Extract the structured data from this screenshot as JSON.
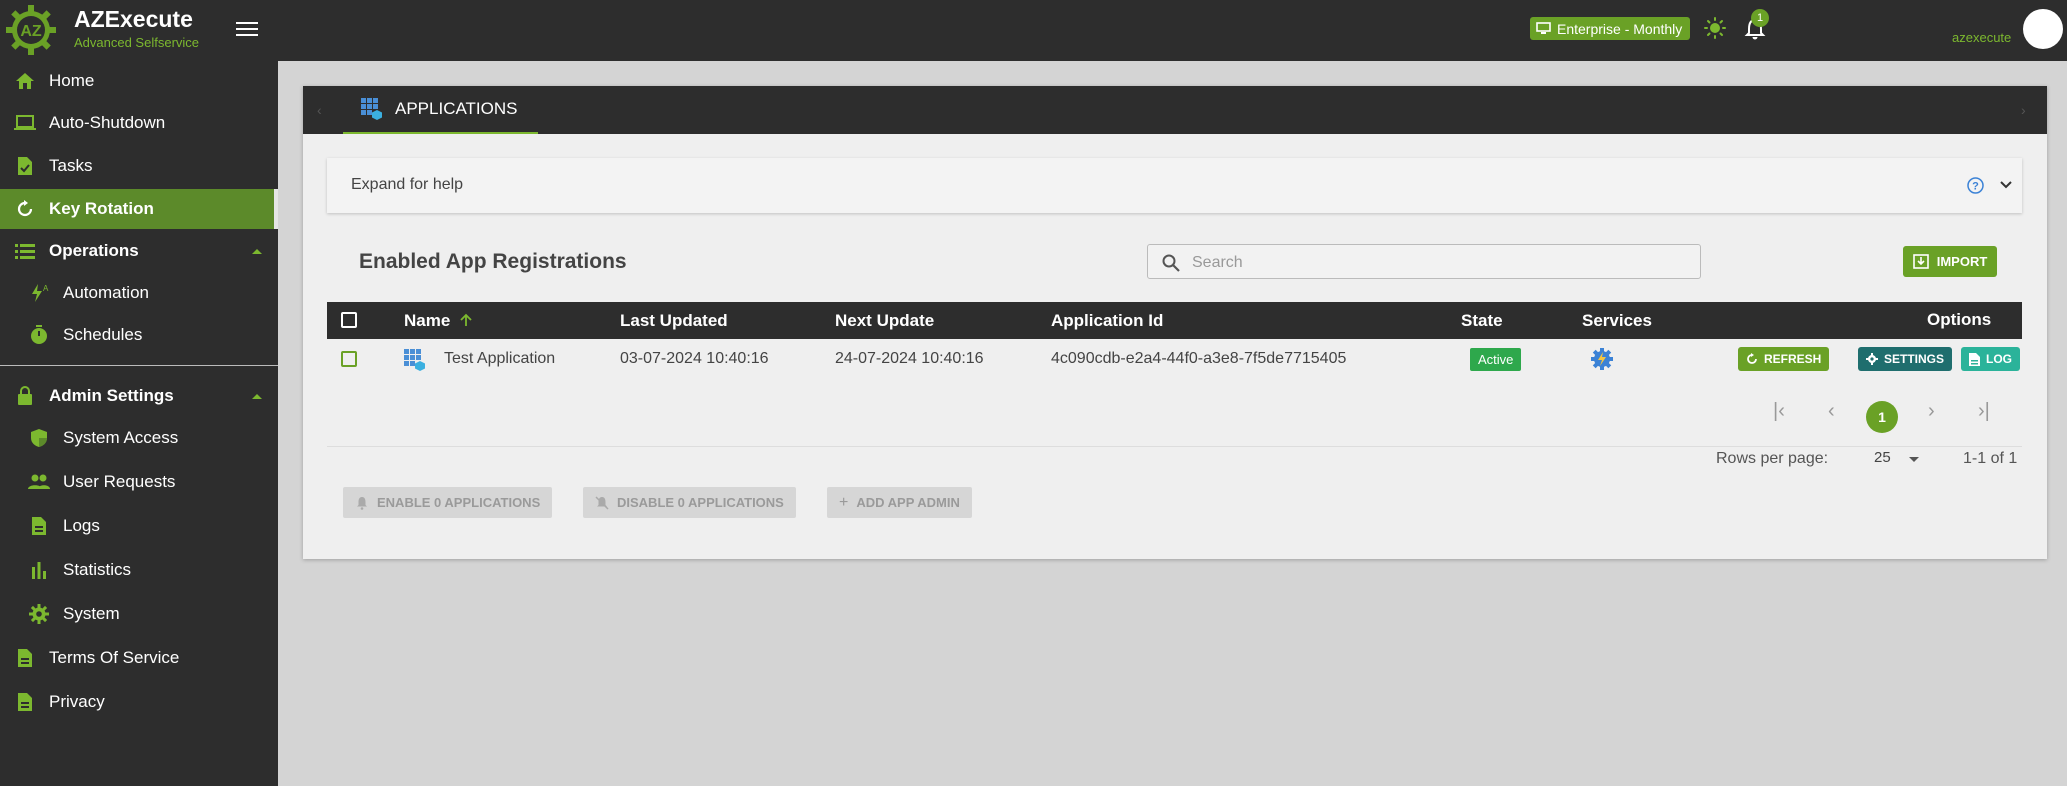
{
  "header": {
    "brand_title": "AZExecute",
    "brand_subtitle": "Advanced Selfservice",
    "logo_text": "AZ",
    "plan_label": "Enterprise - Monthly",
    "notification_count": "1",
    "username": "azexecute"
  },
  "sidebar": {
    "items": [
      {
        "label": "Home",
        "icon": "home-icon"
      },
      {
        "label": "Auto-Shutdown",
        "icon": "laptop-icon"
      },
      {
        "label": "Tasks",
        "icon": "task-icon"
      },
      {
        "label": "Key Rotation",
        "icon": "rotate-icon"
      },
      {
        "label": "Operations",
        "icon": "list-icon"
      },
      {
        "label": "Automation",
        "icon": "automation-icon"
      },
      {
        "label": "Schedules",
        "icon": "timer-icon"
      },
      {
        "label": "Admin Settings",
        "icon": "lock-icon"
      },
      {
        "label": "System Access",
        "icon": "shield-icon"
      },
      {
        "label": "User Requests",
        "icon": "users-icon"
      },
      {
        "label": "Logs",
        "icon": "document-icon"
      },
      {
        "label": "Statistics",
        "icon": "bar-chart-icon"
      },
      {
        "label": "System",
        "icon": "gear-icon"
      },
      {
        "label": "Terms Of Service",
        "icon": "document-icon"
      },
      {
        "label": "Privacy",
        "icon": "document-icon"
      }
    ]
  },
  "tab": {
    "label": "APPLICATIONS"
  },
  "help": {
    "label": "Expand for help"
  },
  "section": {
    "title": "Enabled App Registrations"
  },
  "search": {
    "placeholder": "Search",
    "value": ""
  },
  "toolbar": {
    "import_label": "IMPORT"
  },
  "table": {
    "columns": [
      "Name",
      "Last Updated",
      "Next Update",
      "Application Id",
      "State",
      "Services",
      "Options"
    ],
    "rows": [
      {
        "name": "Test Application",
        "last_updated": "03-07-2024 10:40:16",
        "next_update": "24-07-2024 10:40:16",
        "application_id": "4c090cdb-e2a4-44f0-a3e8-7f5de7715405",
        "state": "Active"
      }
    ],
    "options": {
      "refresh": "REFRESH",
      "settings": "SETTINGS",
      "log": "LOG"
    }
  },
  "pagination": {
    "current_page": "1",
    "rows_per_page_label": "Rows per page:",
    "rows_per_page_value": "25",
    "range": "1-1 of 1"
  },
  "actions": {
    "enable": "ENABLE 0 APPLICATIONS",
    "disable": "DISABLE 0 APPLICATIONS",
    "add_admin": "ADD APP ADMIN"
  },
  "colors": {
    "accent": "#6aa126",
    "dark": "#2d2d2d",
    "active_state": "#2ea84c",
    "settings_button": "#1f6e6e",
    "log_button": "#2bb39a"
  }
}
